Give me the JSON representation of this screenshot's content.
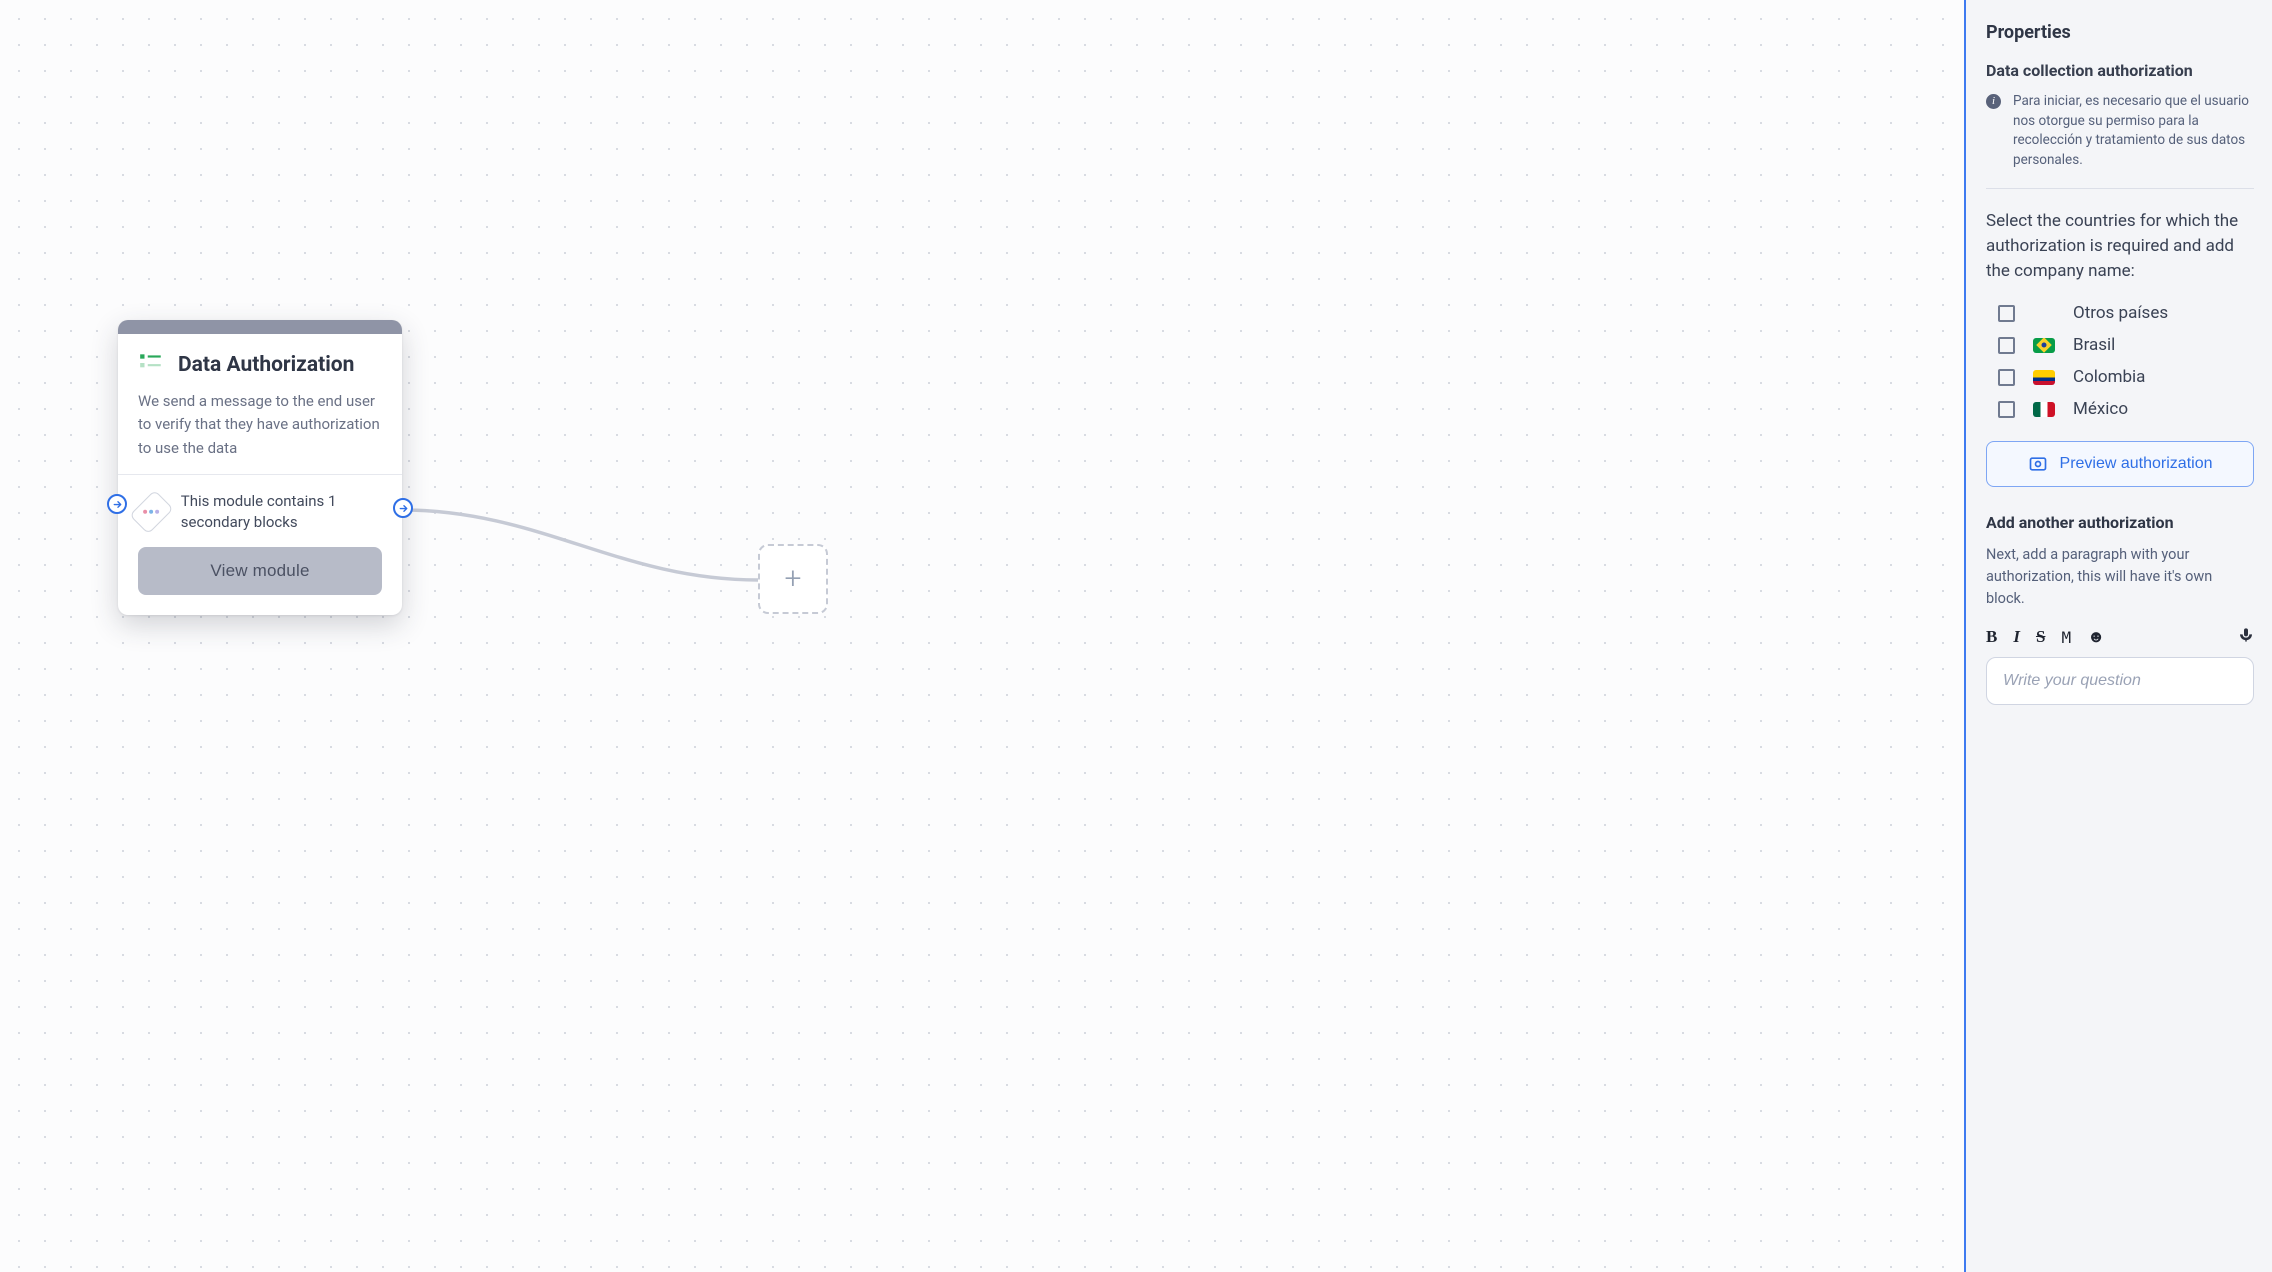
{
  "canvas": {
    "node": {
      "title": "Data Authorization",
      "description": "We send a message to the end user to verify that they have authorization to use the data",
      "module_info": "This module contains 1 secondary blocks",
      "view_module_label": "View module"
    },
    "add_node_icon": "+"
  },
  "sidebar": {
    "title": "Properties",
    "subtitle": "Data collection authorization",
    "info_text": "Para iniciar, es necesario que el usuario nos otorgue su permiso para la recolección y tratamiento de sus datos personales.",
    "instruction": "Select the countries for which the authorization is required and add the company name:",
    "countries": [
      {
        "id": "other",
        "label": "Otros países",
        "flag": null,
        "checked": false
      },
      {
        "id": "brasil",
        "label": "Brasil",
        "flag": "br",
        "checked": false
      },
      {
        "id": "colombia",
        "label": "Colombia",
        "flag": "co",
        "checked": false
      },
      {
        "id": "mexico",
        "label": "México",
        "flag": "mx",
        "checked": false
      }
    ],
    "preview_label": "Preview authorization",
    "add_section": {
      "heading": "Add another authorization",
      "text": "Next, add a paragraph with your authorization, this will have it's own block.",
      "input_placeholder": "Write your question"
    },
    "toolbar": {
      "bold": "B",
      "italic": "I",
      "strike": "S",
      "mono": "M",
      "emoji": "☻"
    }
  }
}
